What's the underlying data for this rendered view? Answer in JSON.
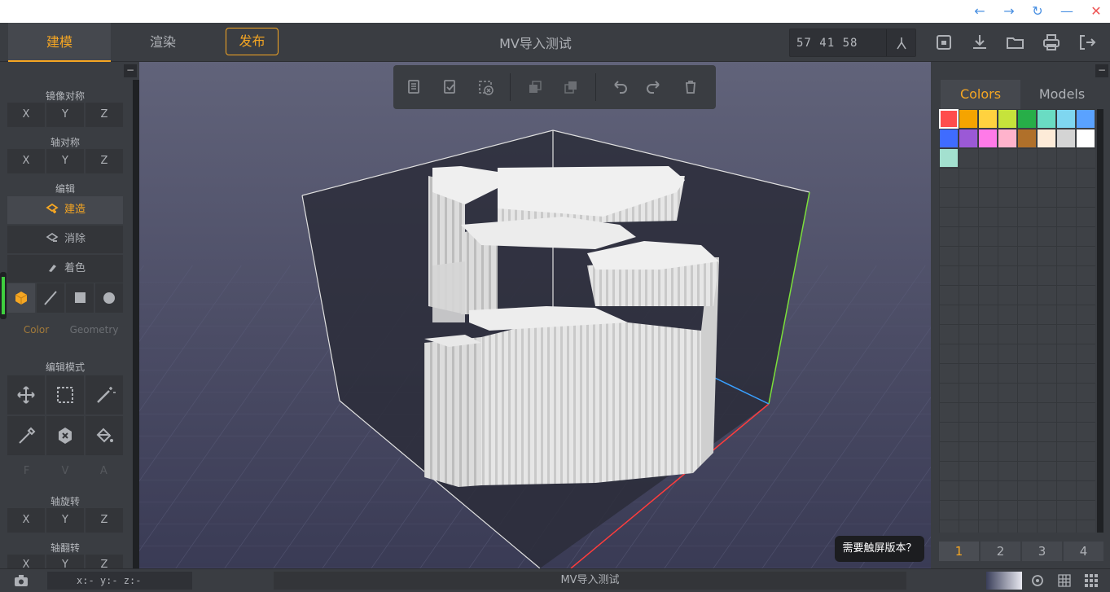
{
  "titlebar": {
    "back": "←",
    "forward": "→",
    "refresh": "↻",
    "minimize": "—",
    "close": "✕"
  },
  "topbar": {
    "tabs": {
      "build": "建模",
      "render": "渲染"
    },
    "publish": "发布",
    "title": "MV导入测试",
    "dimensions": "57 41 58"
  },
  "left": {
    "mirror": {
      "title": "镜像对称",
      "axes": [
        "X",
        "Y",
        "Z"
      ]
    },
    "axis_sym": {
      "title": "轴对称",
      "axes": [
        "X",
        "Y",
        "Z"
      ]
    },
    "edit": {
      "title": "编辑",
      "build": "建造",
      "erase": "消除",
      "paint": "着色"
    },
    "subtabs": {
      "color": "Color",
      "geometry": "Geometry"
    },
    "edit_mode": {
      "title": "编辑模式"
    },
    "fva": [
      "F",
      "V",
      "A"
    ],
    "axis_rotate": {
      "title": "轴旋转",
      "axes": [
        "X",
        "Y",
        "Z"
      ]
    },
    "axis_flip": {
      "title": "轴翻转",
      "axes": [
        "X",
        "Y",
        "Z"
      ]
    },
    "collapse": "−"
  },
  "right": {
    "tabs": {
      "colors": "Colors",
      "models": "Models"
    },
    "palette": [
      "#ff4d4d",
      "#f5a400",
      "#ffd23f",
      "#c6e33b",
      "#27ae48",
      "#6adcc3",
      "#7fd6f0",
      "#5aa2ff",
      "#3f6cff",
      "#9b59d6",
      "#ff7ae8",
      "#ffb3cc",
      "#b0702a",
      "#fdebd8",
      "#d4d4d4",
      "#ffffff",
      "#a3e0cf"
    ],
    "selected": 0,
    "pages": [
      "1",
      "2",
      "3",
      "4"
    ],
    "collapse": "−"
  },
  "viewport": {
    "touch_prompt": "需要触屏版本？"
  },
  "status": {
    "coords": "x:-  y:-  z:-",
    "name": "MV导入测试"
  }
}
